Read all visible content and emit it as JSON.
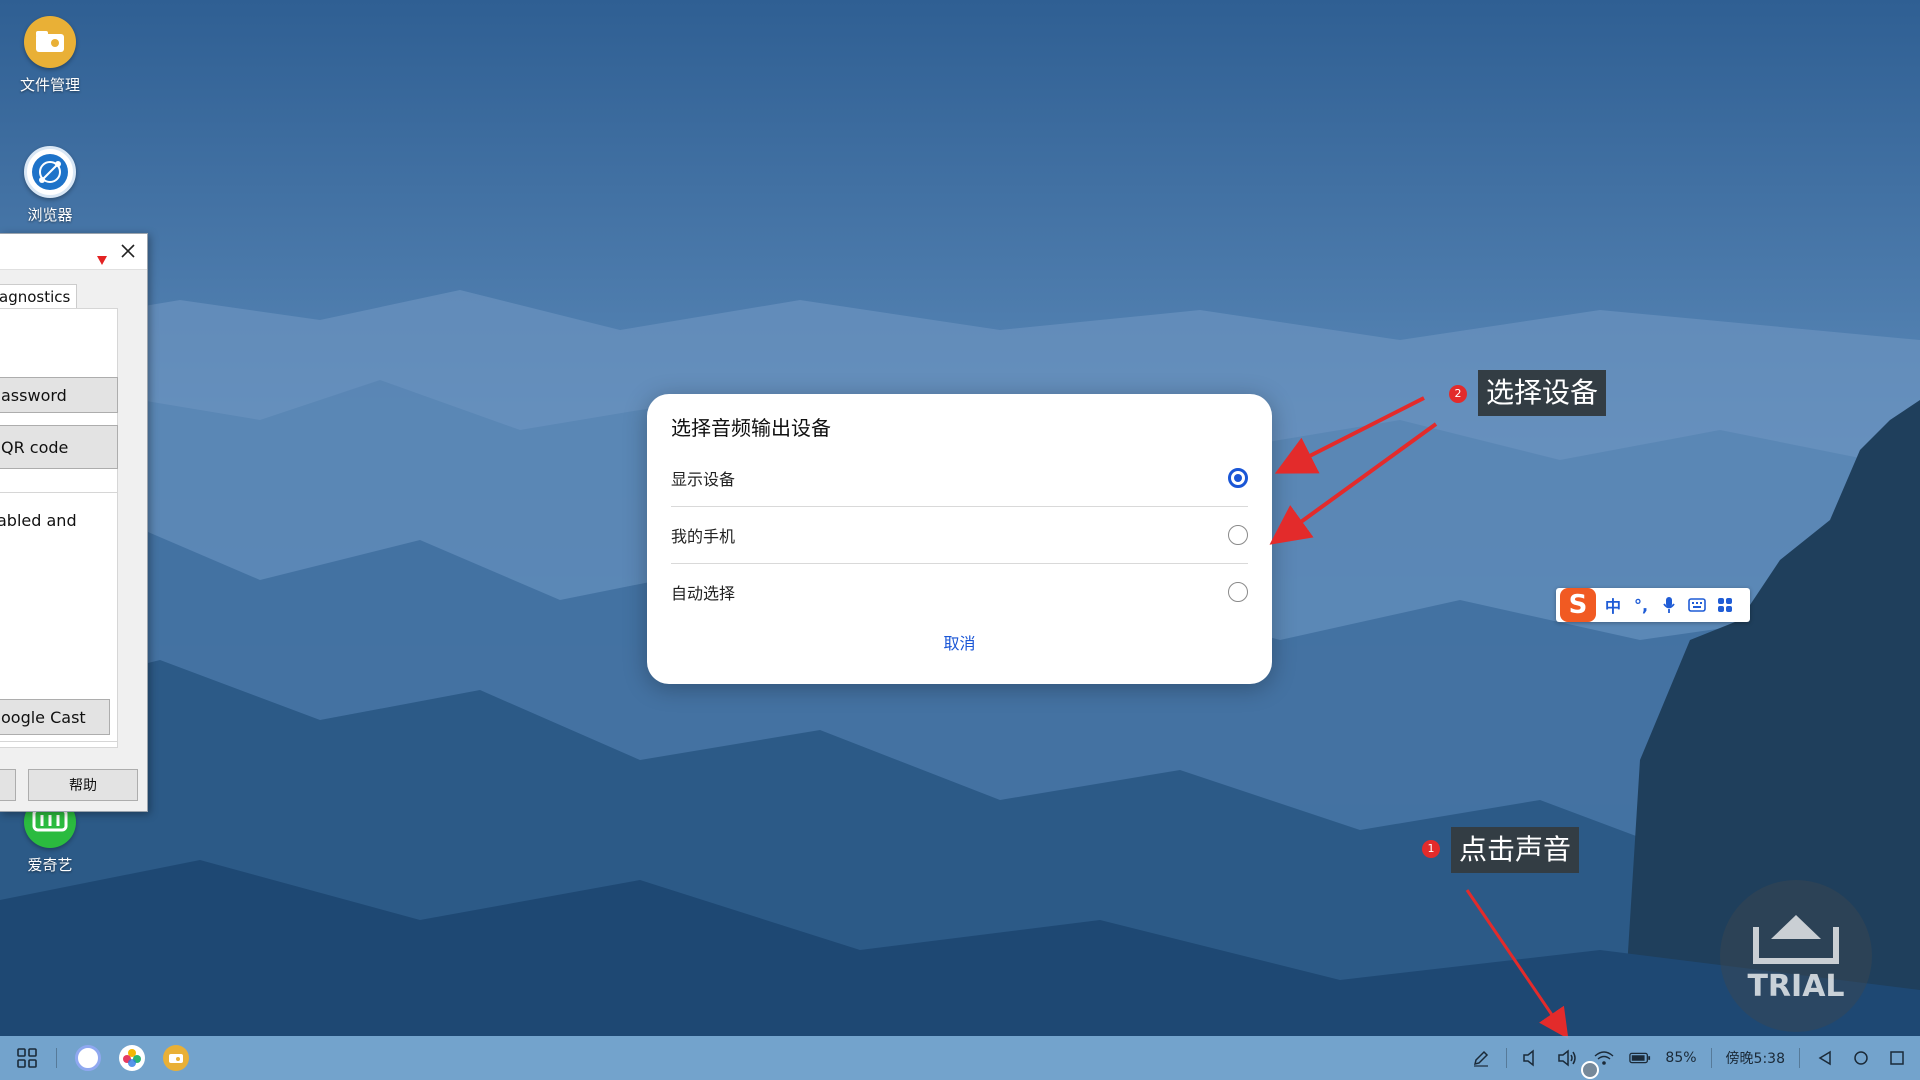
{
  "desktop": {
    "icons": [
      {
        "label": "文件管理",
        "icon": "file-manager-icon"
      },
      {
        "label": "浏览器",
        "icon": "browser-icon"
      },
      {
        "label": "爱奇艺",
        "icon": "iqiyi-icon"
      }
    ]
  },
  "side_window": {
    "tab_label": "agnostics",
    "password_button": "assword",
    "qr_button": "QR code",
    "text_fragment": "abled and",
    "cast_button": "oogle Cast",
    "help_button": "帮助"
  },
  "dialog": {
    "title": "选择音频输出设备",
    "options": [
      {
        "label": "显示设备",
        "selected": true
      },
      {
        "label": "我的手机",
        "selected": false
      },
      {
        "label": "自动选择",
        "selected": false
      }
    ],
    "cancel_label": "取消"
  },
  "annotations": {
    "step2": {
      "number": "2",
      "label": "选择设备"
    },
    "step1": {
      "number": "1",
      "label": "点击声音"
    }
  },
  "ime": {
    "items": [
      "中",
      "°,",
      "mic-icon",
      "keyboard-icon",
      "grid-icon"
    ]
  },
  "watermark": {
    "text": "TRIAL"
  },
  "taskbar": {
    "battery": "85%",
    "clock": "傍晚5:38"
  },
  "colors": {
    "accent": "#1a56d6",
    "annotation_bg": "#333d44",
    "annotation_number": "#e32b2b",
    "arrow": "#e32b2b"
  }
}
